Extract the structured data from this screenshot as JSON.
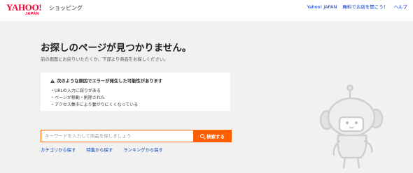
{
  "header": {
    "logo_text": "YAHOO!",
    "logo_sub": "JAPAN",
    "service_name": "ショッピング",
    "links": [
      {
        "label": "Yahoo! JAPAN"
      },
      {
        "label": "無料でお店を開こう！"
      },
      {
        "label": "ヘルプ"
      }
    ]
  },
  "main": {
    "title": "お探しのページが見つかりません。",
    "subtitle": "前の画面にお戻りいただくか、下部より商品をお探しください。",
    "reasons": {
      "heading": "次のような原因でエラーが発生した可能性があります",
      "items": [
        "URLの入力に誤りがある",
        "ページが移動・削除された",
        "アクセス集中により繋がりにくくなっている"
      ]
    },
    "search": {
      "placeholder": "キーワードを入力して商品を探しましょう",
      "value": "",
      "button_label": "検索する"
    },
    "links": [
      {
        "label": "カテゴリから探す"
      },
      {
        "label": "特集から探す"
      },
      {
        "label": "ランキングから探す"
      }
    ]
  },
  "colors": {
    "accent": "#ff5f00",
    "brand": "#ff0033",
    "link": "#0044bb",
    "background": "#f1f1f1"
  },
  "icons": [
    "warning-icon",
    "search-icon",
    "mascot-illustration"
  ]
}
